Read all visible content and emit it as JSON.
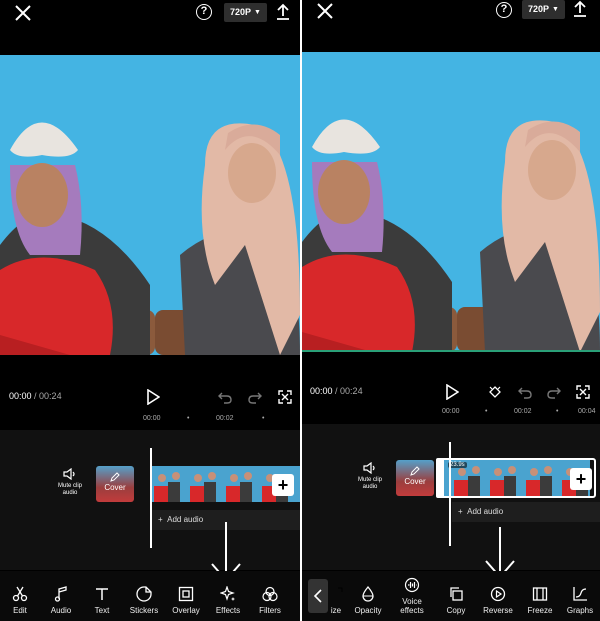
{
  "left": {
    "topbar": {
      "resolution": "720P"
    },
    "player": {
      "current_time": "00:00",
      "separator": " / ",
      "total_time": "00:24"
    },
    "ruler": [
      "00:00",
      "00:02"
    ],
    "timeline": {
      "mute_label_line1": "Mute clip",
      "mute_label_line2": "audio",
      "cover_label": "Cover",
      "add_audio_label": "Add audio"
    },
    "toolbar": [
      {
        "label": "Edit",
        "icon": "scissors-icon"
      },
      {
        "label": "Audio",
        "icon": "music-note-icon"
      },
      {
        "label": "Text",
        "icon": "text-icon"
      },
      {
        "label": "Stickers",
        "icon": "sticker-icon"
      },
      {
        "label": "Overlay",
        "icon": "overlay-icon"
      },
      {
        "label": "Effects",
        "icon": "sparkle-icon"
      },
      {
        "label": "Filters",
        "icon": "filters-icon"
      }
    ]
  },
  "right": {
    "topbar": {
      "resolution": "720P"
    },
    "player": {
      "current_time": "00:00",
      "separator": " / ",
      "total_time": "00:24"
    },
    "ruler": [
      "00:00",
      "00:02",
      "00:04"
    ],
    "timeline": {
      "mute_label_line1": "Mute clip",
      "mute_label_line2": "audio",
      "cover_label": "Cover",
      "duration_badge": "23.9s",
      "add_audio_label": "Add audio"
    },
    "toolbar": [
      {
        "label": "ize",
        "icon": "resize-icon"
      },
      {
        "label": "Opacity",
        "icon": "opacity-icon"
      },
      {
        "label": "Voice effects",
        "icon": "voice-effects-icon"
      },
      {
        "label": "Copy",
        "icon": "copy-icon"
      },
      {
        "label": "Reverse",
        "icon": "reverse-icon"
      },
      {
        "label": "Freeze",
        "icon": "freeze-icon"
      },
      {
        "label": "Graphs",
        "icon": "graphs-icon"
      }
    ]
  },
  "colors": {
    "background": "#000000",
    "preview_blue": "#44b4e3",
    "timeline_strip": "#4aa3cf",
    "accent_green": "#2aa078"
  }
}
